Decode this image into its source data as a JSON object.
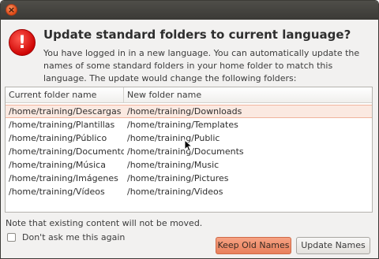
{
  "window": {
    "close_icon": "×"
  },
  "dialog": {
    "warning_icon": "!",
    "title": "Update standard folders to current language?",
    "message": "You have logged in in a new language. You can automatically update the names of some standard folders in your home folder to match this language. The update would change the following folders:"
  },
  "table": {
    "columns": [
      "Current folder name",
      "New folder name"
    ],
    "rows": [
      [
        "/home/training/Descargas",
        "/home/training/Downloads"
      ],
      [
        "/home/training/Plantillas",
        "/home/training/Templates"
      ],
      [
        "/home/training/Público",
        "/home/training/Public"
      ],
      [
        "/home/training/Documentos",
        "/home/training/Documents"
      ],
      [
        "/home/training/Música",
        "/home/training/Music"
      ],
      [
        "/home/training/Imágenes",
        "/home/training/Pictures"
      ],
      [
        "/home/training/Vídeos",
        "/home/training/Videos"
      ]
    ],
    "selected_row": 0
  },
  "note": "Note that existing content will not be moved.",
  "checkbox": {
    "label": "Don't ask me this again",
    "checked": false
  },
  "buttons": {
    "keep": "Keep Old Names",
    "update": "Update Names"
  },
  "colors": {
    "accent": "#e9805c",
    "titlebar": "#3c3b37",
    "warning": "#cc0000"
  }
}
